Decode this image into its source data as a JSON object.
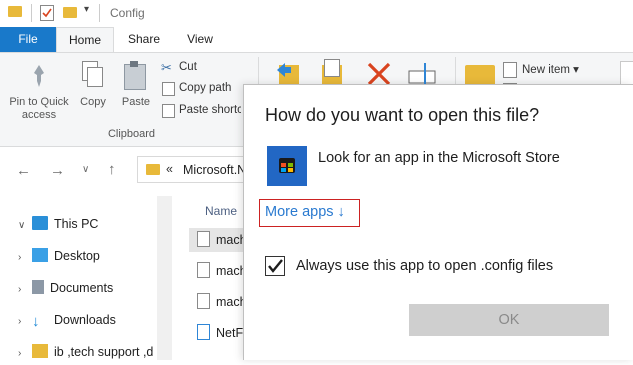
{
  "window": {
    "title": "Config"
  },
  "ribbon": {
    "tabs": [
      "File",
      "Home",
      "Share",
      "View"
    ],
    "pin_label": "Pin to Quick access",
    "copy_label": "Copy",
    "paste_label": "Paste",
    "cut_label": "Cut",
    "copy_path_label": "Copy path",
    "paste_shortcut_label": "Paste shortc",
    "clipboard_group": "Clipboard",
    "new_item_label": "New item"
  },
  "address": {
    "crumb_sep": "«",
    "path": "Microsoft.N"
  },
  "nav_tree": [
    {
      "label": "This PC",
      "chevron": "v"
    },
    {
      "label": "Desktop",
      "chevron": ">"
    },
    {
      "label": "Documents",
      "chevron": ">"
    },
    {
      "label": "Downloads",
      "chevron": ">"
    },
    {
      "label": "ib ,tech support ,d",
      "chevron": ">"
    }
  ],
  "file_list": {
    "column_name": "Name",
    "files": [
      "mach",
      "mach",
      "mach",
      "NetFx"
    ]
  },
  "dialog": {
    "title": "How do you want to open this file?",
    "store_option": "Look for an app in the Microsoft Store",
    "more_apps": "More apps ↓",
    "always_use": "Always use this app to open .config files",
    "always_checked": true,
    "ok_label": "OK"
  },
  "colors": {
    "accent": "#1979ca",
    "link": "#2a7ad0",
    "highlight_border": "#cc2222",
    "store_tile": "#2267c4"
  }
}
